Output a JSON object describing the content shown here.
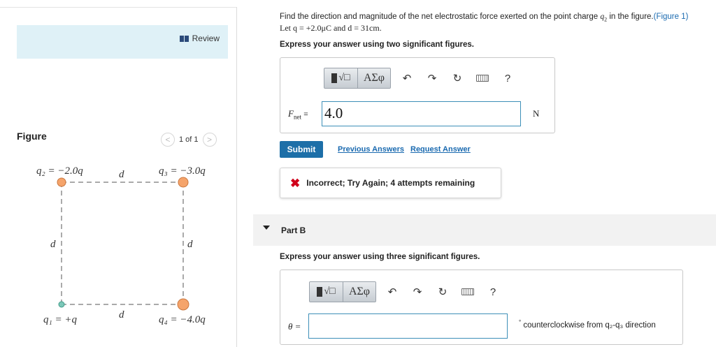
{
  "figure_panel": {
    "review_label": "Review",
    "figure_label": "Figure",
    "pager": {
      "text": "1 of 1",
      "prev": "<",
      "next": ">"
    },
    "labels": {
      "q2": "q₂ = −2.0q",
      "q3": "q₃ = −3.0q",
      "q1": "q₁ = +q",
      "q4": "q₄ = −4.0q",
      "d_top": "d",
      "d_bottom": "d",
      "d_left": "d",
      "d_right": "d"
    },
    "colors": {
      "negative_charge": "#f5a46b",
      "positive_charge": "#7cc7b8",
      "edge": "#555555"
    }
  },
  "part_a": {
    "problem_text_start": "Find the direction and magnitude of the net electrostatic force exerted on the point charge ",
    "problem_q": "q",
    "problem_q_sub": "2",
    "problem_text_end": " in the figure.",
    "figure_link": "(Figure 1)",
    "let_line": "Let q = +2.0μC and d = 31cm.",
    "instruction": "Express your answer using two significant figures.",
    "toolbar": {
      "template": "√□",
      "greek": "ΑΣφ",
      "undo": "↶",
      "redo": "↷",
      "reset": "↻",
      "help": "?"
    },
    "answer_label": "F",
    "answer_label_sub": "net",
    "answer_equals": "=",
    "answer_value": "4.0",
    "unit": "N",
    "submit": "Submit",
    "previous_answers": "Previous Answers",
    "request_answer": "Request Answer",
    "feedback_icon": "✖",
    "feedback_text": "Incorrect; Try Again; 4 attempts remaining"
  },
  "part_b": {
    "title": "Part B",
    "instruction": "Express your answer using three significant figures.",
    "toolbar": {
      "template": "√□",
      "greek": "ΑΣφ",
      "undo": "↶",
      "redo": "↷",
      "reset": "↻",
      "help": "?"
    },
    "answer_label": "θ =",
    "answer_value": "",
    "unit_degree": "°",
    "unit_text": " counterclockwise from q₂-q₃ direction"
  },
  "colors": {
    "accent_blue": "#1d6fa8",
    "link_blue": "#1a6ab0",
    "error_red": "#d0021b",
    "review_bg": "#dff1f7"
  }
}
